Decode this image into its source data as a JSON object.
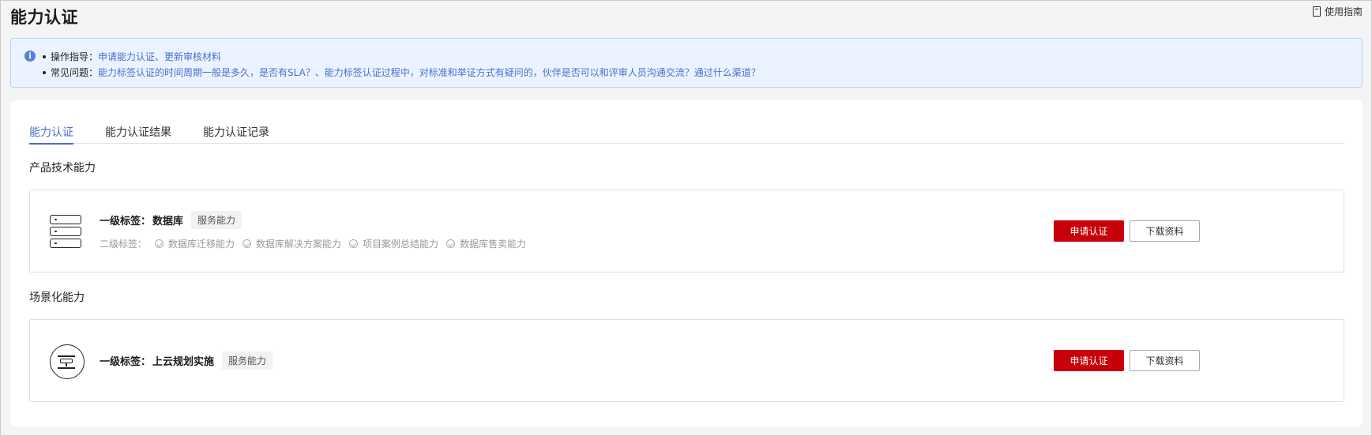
{
  "header": {
    "title": "能力认证",
    "guide_label": "使用指南"
  },
  "notice": {
    "row1_label": "操作指导：",
    "row1_link": "申请能力认证、更新审核材料",
    "row2_label": "常见问题：",
    "row2_link": "能力标签认证的时间周期一般是多久，是否有SLA？、能力标签认证过程中，对标准和举证方式有疑问的，伙伴是否可以和评审人员沟通交流？通过什么渠道？"
  },
  "tabs": [
    {
      "label": "能力认证",
      "active": true
    },
    {
      "label": "能力认证结果",
      "active": false
    },
    {
      "label": "能力认证记录",
      "active": false
    }
  ],
  "sections": [
    {
      "title": "产品技术能力",
      "item": {
        "icon": "database-server-icon",
        "level1_prefix": "一级标签：",
        "level1_value": "数据库",
        "badge": "服务能力",
        "level2_prefix": "二级标签：",
        "level2": [
          "数据库迁移能力",
          "数据库解决方案能力",
          "项目案例总结能力",
          "数据库售卖能力"
        ],
        "apply_label": "申请认证",
        "download_label": "下载资料"
      }
    },
    {
      "title": "场景化能力",
      "item": {
        "icon": "cloud-planning-icon",
        "level1_prefix": "一级标签：",
        "level1_value": "上云规划实施",
        "badge": "服务能力",
        "apply_label": "申请认证",
        "download_label": "下载资料"
      }
    }
  ],
  "colors": {
    "accent": "#4a6fd1",
    "primary_button": "#c7000b",
    "notice_bg": "#eaf3ff"
  }
}
